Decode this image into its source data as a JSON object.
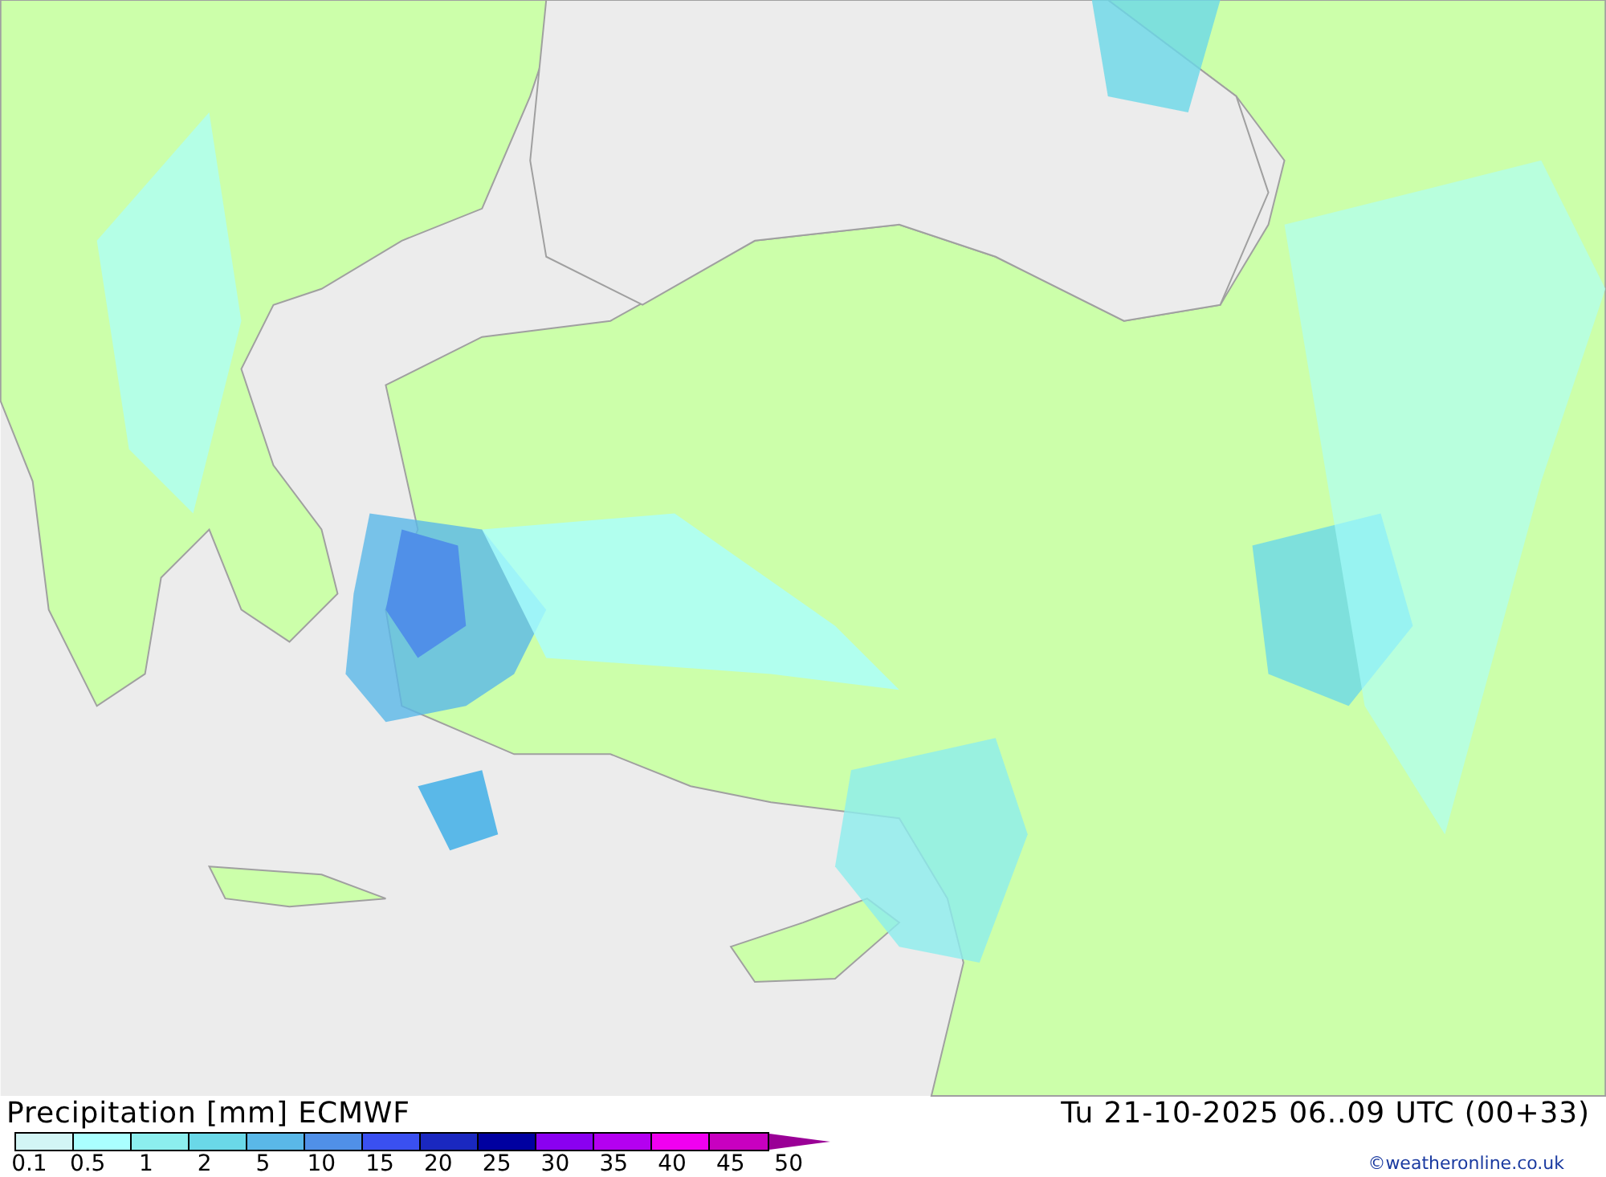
{
  "title": "Precipitation [mm] ECMWF",
  "valid_time": "Tu 21-10-2025 06..09 UTC (00+33)",
  "legend": {
    "bins": [
      {
        "label": "0.1",
        "color": "#d2f5f5"
      },
      {
        "label": "0.5",
        "color": "#aaffff"
      },
      {
        "label": "1",
        "color": "#8ceeee"
      },
      {
        "label": "2",
        "color": "#6ad8e8"
      },
      {
        "label": "5",
        "color": "#5ab8e8"
      },
      {
        "label": "10",
        "color": "#5090e8"
      },
      {
        "label": "15",
        "color": "#3a50f0"
      },
      {
        "label": "20",
        "color": "#1a28c0"
      },
      {
        "label": "25",
        "color": "#0000a0"
      },
      {
        "label": "30",
        "color": "#8a00f0"
      },
      {
        "label": "35",
        "color": "#b400f0"
      },
      {
        "label": "40",
        "color": "#f000f0"
      },
      {
        "label": "45",
        "color": "#c800c0"
      }
    ],
    "last_label": "50",
    "overflow_arrow": {
      "color": "#9a0096"
    }
  },
  "credit": "©weatheronline.co.uk"
}
